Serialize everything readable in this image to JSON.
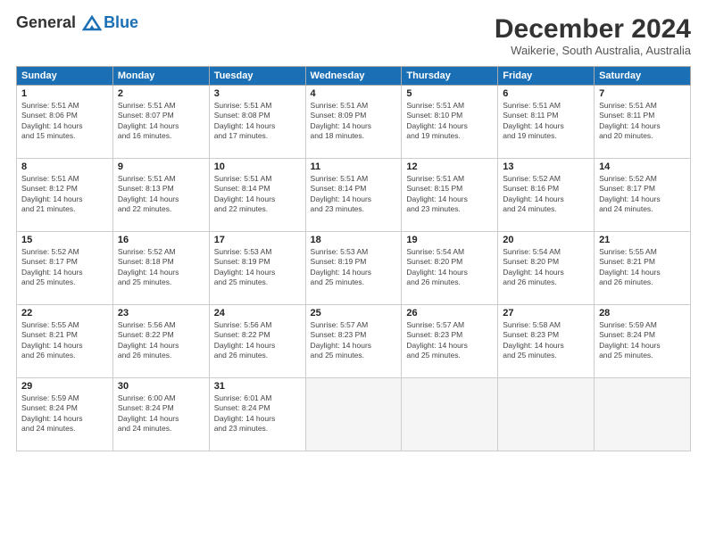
{
  "header": {
    "logo_line1": "General",
    "logo_line2": "Blue",
    "month_title": "December 2024",
    "location": "Waikerie, South Australia, Australia"
  },
  "weekdays": [
    "Sunday",
    "Monday",
    "Tuesday",
    "Wednesday",
    "Thursday",
    "Friday",
    "Saturday"
  ],
  "weeks": [
    [
      {
        "day": "1",
        "detail": "Sunrise: 5:51 AM\nSunset: 8:06 PM\nDaylight: 14 hours\nand 15 minutes."
      },
      {
        "day": "2",
        "detail": "Sunrise: 5:51 AM\nSunset: 8:07 PM\nDaylight: 14 hours\nand 16 minutes."
      },
      {
        "day": "3",
        "detail": "Sunrise: 5:51 AM\nSunset: 8:08 PM\nDaylight: 14 hours\nand 17 minutes."
      },
      {
        "day": "4",
        "detail": "Sunrise: 5:51 AM\nSunset: 8:09 PM\nDaylight: 14 hours\nand 18 minutes."
      },
      {
        "day": "5",
        "detail": "Sunrise: 5:51 AM\nSunset: 8:10 PM\nDaylight: 14 hours\nand 19 minutes."
      },
      {
        "day": "6",
        "detail": "Sunrise: 5:51 AM\nSunset: 8:11 PM\nDaylight: 14 hours\nand 19 minutes."
      },
      {
        "day": "7",
        "detail": "Sunrise: 5:51 AM\nSunset: 8:11 PM\nDaylight: 14 hours\nand 20 minutes."
      }
    ],
    [
      {
        "day": "8",
        "detail": "Sunrise: 5:51 AM\nSunset: 8:12 PM\nDaylight: 14 hours\nand 21 minutes."
      },
      {
        "day": "9",
        "detail": "Sunrise: 5:51 AM\nSunset: 8:13 PM\nDaylight: 14 hours\nand 22 minutes."
      },
      {
        "day": "10",
        "detail": "Sunrise: 5:51 AM\nSunset: 8:14 PM\nDaylight: 14 hours\nand 22 minutes."
      },
      {
        "day": "11",
        "detail": "Sunrise: 5:51 AM\nSunset: 8:14 PM\nDaylight: 14 hours\nand 23 minutes."
      },
      {
        "day": "12",
        "detail": "Sunrise: 5:51 AM\nSunset: 8:15 PM\nDaylight: 14 hours\nand 23 minutes."
      },
      {
        "day": "13",
        "detail": "Sunrise: 5:52 AM\nSunset: 8:16 PM\nDaylight: 14 hours\nand 24 minutes."
      },
      {
        "day": "14",
        "detail": "Sunrise: 5:52 AM\nSunset: 8:17 PM\nDaylight: 14 hours\nand 24 minutes."
      }
    ],
    [
      {
        "day": "15",
        "detail": "Sunrise: 5:52 AM\nSunset: 8:17 PM\nDaylight: 14 hours\nand 25 minutes."
      },
      {
        "day": "16",
        "detail": "Sunrise: 5:52 AM\nSunset: 8:18 PM\nDaylight: 14 hours\nand 25 minutes."
      },
      {
        "day": "17",
        "detail": "Sunrise: 5:53 AM\nSunset: 8:19 PM\nDaylight: 14 hours\nand 25 minutes."
      },
      {
        "day": "18",
        "detail": "Sunrise: 5:53 AM\nSunset: 8:19 PM\nDaylight: 14 hours\nand 25 minutes."
      },
      {
        "day": "19",
        "detail": "Sunrise: 5:54 AM\nSunset: 8:20 PM\nDaylight: 14 hours\nand 26 minutes."
      },
      {
        "day": "20",
        "detail": "Sunrise: 5:54 AM\nSunset: 8:20 PM\nDaylight: 14 hours\nand 26 minutes."
      },
      {
        "day": "21",
        "detail": "Sunrise: 5:55 AM\nSunset: 8:21 PM\nDaylight: 14 hours\nand 26 minutes."
      }
    ],
    [
      {
        "day": "22",
        "detail": "Sunrise: 5:55 AM\nSunset: 8:21 PM\nDaylight: 14 hours\nand 26 minutes."
      },
      {
        "day": "23",
        "detail": "Sunrise: 5:56 AM\nSunset: 8:22 PM\nDaylight: 14 hours\nand 26 minutes."
      },
      {
        "day": "24",
        "detail": "Sunrise: 5:56 AM\nSunset: 8:22 PM\nDaylight: 14 hours\nand 26 minutes."
      },
      {
        "day": "25",
        "detail": "Sunrise: 5:57 AM\nSunset: 8:23 PM\nDaylight: 14 hours\nand 25 minutes."
      },
      {
        "day": "26",
        "detail": "Sunrise: 5:57 AM\nSunset: 8:23 PM\nDaylight: 14 hours\nand 25 minutes."
      },
      {
        "day": "27",
        "detail": "Sunrise: 5:58 AM\nSunset: 8:23 PM\nDaylight: 14 hours\nand 25 minutes."
      },
      {
        "day": "28",
        "detail": "Sunrise: 5:59 AM\nSunset: 8:24 PM\nDaylight: 14 hours\nand 25 minutes."
      }
    ],
    [
      {
        "day": "29",
        "detail": "Sunrise: 5:59 AM\nSunset: 8:24 PM\nDaylight: 14 hours\nand 24 minutes."
      },
      {
        "day": "30",
        "detail": "Sunrise: 6:00 AM\nSunset: 8:24 PM\nDaylight: 14 hours\nand 24 minutes."
      },
      {
        "day": "31",
        "detail": "Sunrise: 6:01 AM\nSunset: 8:24 PM\nDaylight: 14 hours\nand 23 minutes."
      },
      {
        "day": "",
        "detail": ""
      },
      {
        "day": "",
        "detail": ""
      },
      {
        "day": "",
        "detail": ""
      },
      {
        "day": "",
        "detail": ""
      }
    ]
  ]
}
